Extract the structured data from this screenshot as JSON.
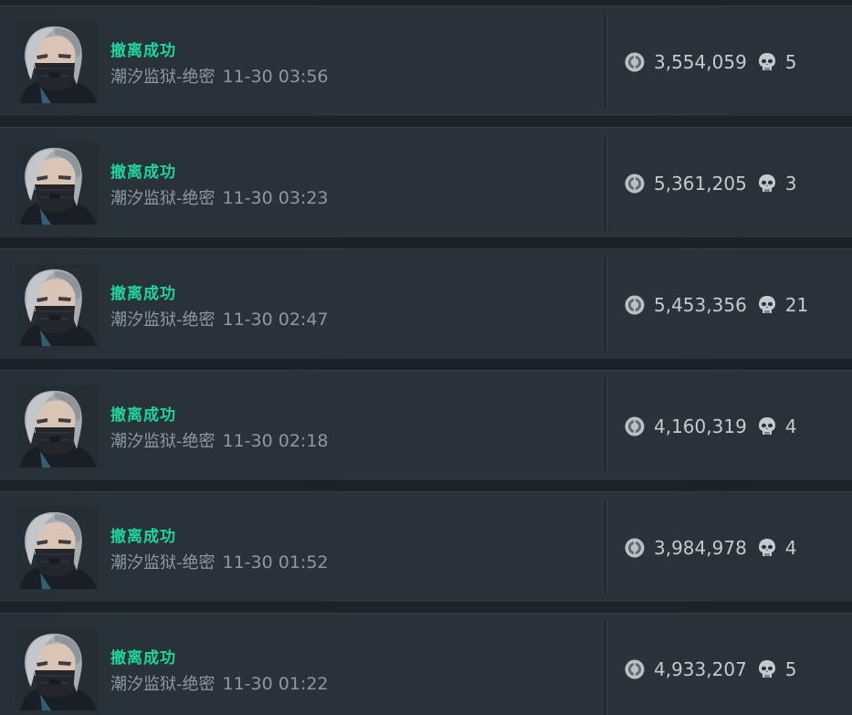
{
  "colors": {
    "status_green": "#22d39a",
    "meta_gray": "#8d98a3",
    "value_light": "#c3cad1",
    "row_bg": "#29323b"
  },
  "icons": {
    "currency": "coin-icon",
    "kills": "skull-icon"
  },
  "records": [
    {
      "status": "撤离成功",
      "map": "潮汐监狱-绝密",
      "time": "11-30 03:56",
      "value": "3,554,059",
      "kills": "5"
    },
    {
      "status": "撤离成功",
      "map": "潮汐监狱-绝密",
      "time": "11-30 03:23",
      "value": "5,361,205",
      "kills": "3"
    },
    {
      "status": "撤离成功",
      "map": "潮汐监狱-绝密",
      "time": "11-30 02:47",
      "value": "5,453,356",
      "kills": "21"
    },
    {
      "status": "撤离成功",
      "map": "潮汐监狱-绝密",
      "time": "11-30 02:18",
      "value": "4,160,319",
      "kills": "4"
    },
    {
      "status": "撤离成功",
      "map": "潮汐监狱-绝密",
      "time": "11-30 01:52",
      "value": "3,984,978",
      "kills": "4"
    },
    {
      "status": "撤离成功",
      "map": "潮汐监狱-绝密",
      "time": "11-30 01:22",
      "value": "4,933,207",
      "kills": "5"
    }
  ]
}
